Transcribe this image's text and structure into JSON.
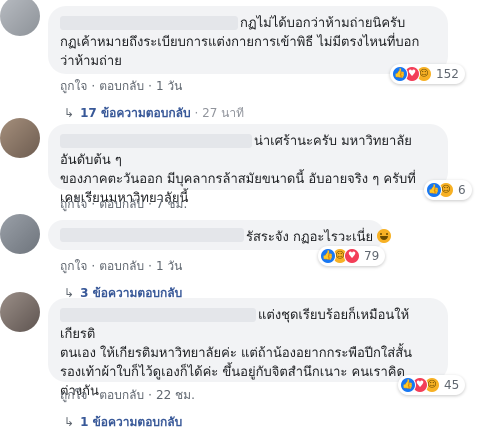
{
  "comments": [
    {
      "text": "กฏไม่ได้บอกว่าห้ามถ่ายนิครับ\nกฏเค้าหมายถึงระเบียบการแต่งกายการเข้าพิธี ไม่มีตรงไหนที่บอก\nว่าห้ามถ่าย",
      "like_label": "ถูกใจ",
      "reply_label": "ตอบกลับ",
      "time": "1 วัน",
      "reaction_count": "152",
      "replies_label": "17 ข้อความตอบกลับ",
      "replies_time": "27 นาที"
    },
    {
      "text": "น่าเศร้านะครับ มหาวิทยาลัยอันดับต้น ๆ\nของภาคตะวันออก มีบุคลากรล้าสมัยขนาดนี้ อับอายจริง ๆ ครับที่\nเคยเรียนมหาวิทยาลัยนี้",
      "like_label": "ถูกใจ",
      "reply_label": "ตอบกลับ",
      "time": "7 ชม.",
      "reaction_count": "6"
    },
    {
      "text": "รัสระจัง กฏอะไรวะเนี่ย",
      "like_label": "ถูกใจ",
      "reply_label": "ตอบกลับ",
      "time": "1 วัน",
      "reaction_count": "79",
      "replies_label": "3 ข้อความตอบกลับ"
    },
    {
      "text": "แต่งชุดเรียบร้อยก็เหมือนให้เกียรติ\nตนเอง ให้เกียรติมหาวิทยาลัยค่ะ แต่ถ้าน้องอยากกระพือปีกใส่สั้น\nรองเท้าผ้าใบก็ไว้ดูเองก็ได้ค่ะ ขึ้นอยู่กับจิตสำนึกเนาะ คนเราคิด\nต่างกัน",
      "like_label": "ถูกใจ",
      "reply_label": "ตอบกลับ",
      "time": "22 ชม.",
      "reaction_count": "45",
      "replies_label": "1 ข้อความตอบกลับ"
    }
  ],
  "colors": {
    "bubble": "#f2f3f5",
    "link": "#385898",
    "meta": "#606770",
    "like": "#1877f2",
    "love": "#f33e58",
    "haha": "#f7b125"
  },
  "icons": {
    "reaction_like": "like-icon",
    "reaction_love": "love-icon",
    "reaction_haha": "haha-icon",
    "reply_arrow": "reply-arrow-icon"
  }
}
